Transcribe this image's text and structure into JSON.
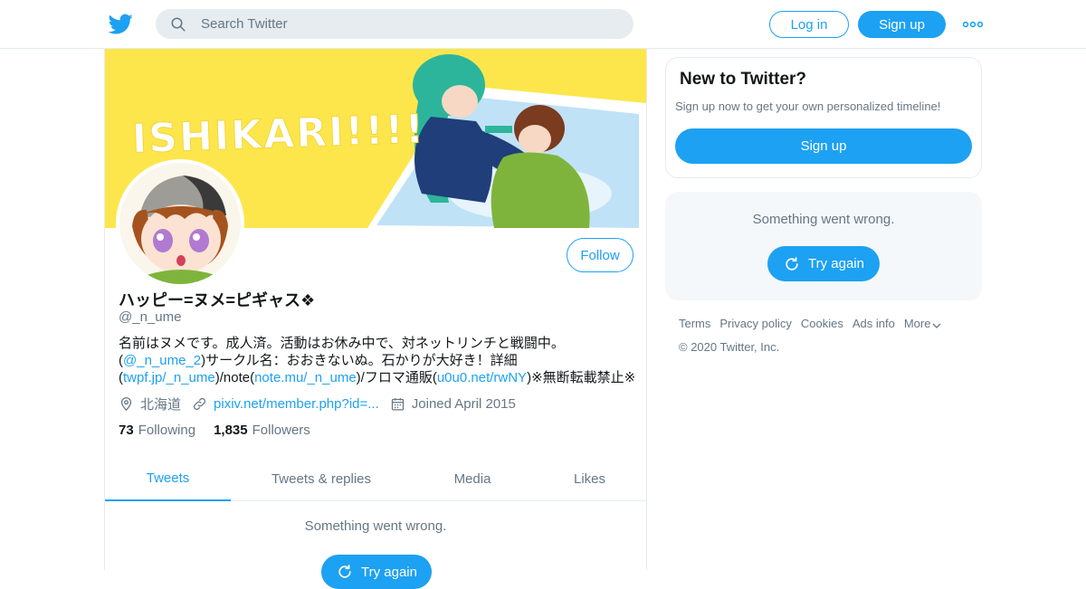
{
  "header": {
    "logo_icon": "twitter-bird-icon",
    "search_placeholder": "Search Twitter",
    "login_label": "Log in",
    "signup_label": "Sign up",
    "more_icon": "more-dots-icon"
  },
  "profile": {
    "banner_text": "ISHIKARI!!!!",
    "display_name": "ハッピー=ヌメ=ピギャス❖",
    "handle": "@_n_ume",
    "follow_label": "Follow",
    "bio": {
      "line1": "名前はヌメです。成人済。活動はお休み中で、対ネットリンチと戦闘中。",
      "l2_open": "(",
      "l2_link": "@_n_ume_2",
      "l2_rest": ")サークル名：おおきないぬ。石かりが大好き！詳細",
      "l3_open": "(",
      "l3_link1": "twpf.jp/_n_ume",
      "l3_mid1": ")/note(",
      "l3_link2": "note.mu/_n_ume",
      "l3_mid2": ")/フロマ通販(",
      "l3_link3": "u0u0.net/rwNY",
      "l3_end": ")※無断転載禁止※"
    },
    "location": "北海道",
    "website": "pixiv.net/member.php?id=...",
    "joined": "Joined April 2015",
    "following_count": "73",
    "following_label": "Following",
    "followers_count": "1,835",
    "followers_label": "Followers",
    "tabs": [
      {
        "label": "Tweets",
        "active": true
      },
      {
        "label": "Tweets & replies",
        "active": false
      },
      {
        "label": "Media",
        "active": false
      },
      {
        "label": "Likes",
        "active": false
      }
    ],
    "error_message": "Something went wrong.",
    "try_again_label": "Try again"
  },
  "sidebar": {
    "new_title": "New to Twitter?",
    "new_subtitle": "Sign up now to get your own personalized timeline!",
    "signup_label": "Sign up",
    "error_message": "Something went wrong.",
    "try_again_label": "Try again"
  },
  "footer": {
    "links": [
      "Terms",
      "Privacy policy",
      "Cookies",
      "Ads info",
      "More"
    ],
    "copyright": "© 2020 Twitter, Inc."
  },
  "colors": {
    "accent": "#1da1f2",
    "text_secondary": "#657786",
    "banner_yellow": "#fde64b",
    "border": "#e6ecf0"
  }
}
